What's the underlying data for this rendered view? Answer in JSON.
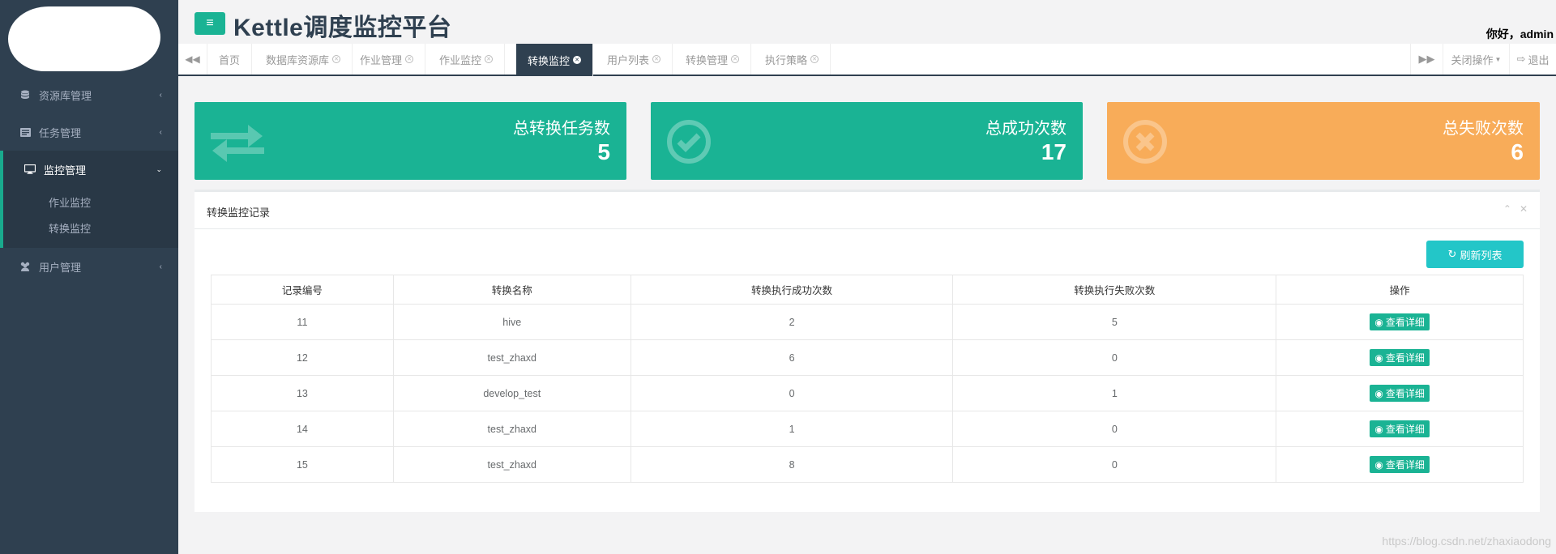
{
  "header": {
    "title": "Kettle调度监控平台",
    "greeting": "你好，admin",
    "menu_icon": "hamburger-icon"
  },
  "sidebar": {
    "items": [
      {
        "label": "资源库管理",
        "icon": "database-icon"
      },
      {
        "label": "任务管理",
        "icon": "tasks-icon"
      },
      {
        "label": "监控管理",
        "icon": "monitor-icon",
        "active": true,
        "children": [
          "作业监控",
          "转换监控"
        ]
      },
      {
        "label": "用户管理",
        "icon": "users-icon"
      }
    ]
  },
  "tabs": {
    "items": [
      "首页",
      "数据库资源库",
      "作业管理",
      "作业监控",
      "转换监控",
      "用户列表",
      "转换管理",
      "执行策略"
    ],
    "active": "转换监控",
    "close_ops": "关闭操作",
    "logout": "退出"
  },
  "stats": [
    {
      "title": "总转换任务数",
      "value": "5",
      "color": "#1ab394",
      "icon": "exchange-icon"
    },
    {
      "title": "总成功次数",
      "value": "17",
      "color": "#1ab394",
      "icon": "check-circle-icon"
    },
    {
      "title": "总失败次数",
      "value": "6",
      "color": "#f8ac59",
      "icon": "times-circle-icon"
    }
  ],
  "panel": {
    "title": "转换监控记录",
    "refresh_label": "刷新列表",
    "columns": [
      "记录编号",
      "转换名称",
      "转换执行成功次数",
      "转换执行失败次数",
      "操作"
    ],
    "rows": [
      {
        "id": "11",
        "name": "hive",
        "success": "2",
        "fail": "5",
        "action": "查看详细"
      },
      {
        "id": "12",
        "name": "test_zhaxd",
        "success": "6",
        "fail": "0",
        "action": "查看详细"
      },
      {
        "id": "13",
        "name": "develop_test",
        "success": "0",
        "fail": "1",
        "action": "查看详细"
      },
      {
        "id": "14",
        "name": "test_zhaxd",
        "success": "1",
        "fail": "0",
        "action": "查看详细"
      },
      {
        "id": "15",
        "name": "test_zhaxd",
        "success": "8",
        "fail": "0",
        "action": "查看详细"
      }
    ]
  },
  "watermark": "https://blog.csdn.net/zhaxiaodong",
  "colors": {
    "sidebar": "#2f4050",
    "accent": "#1ab394",
    "warning": "#f8ac59",
    "info": "#23c6c8"
  }
}
